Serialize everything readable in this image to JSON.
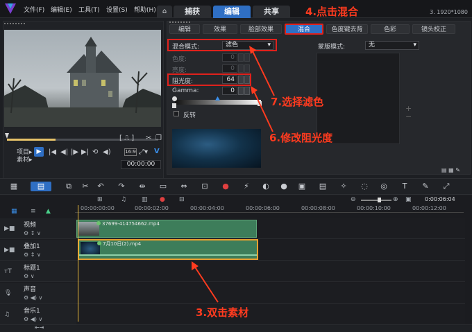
{
  "menu": [
    "文件(F)",
    "编辑(E)",
    "工具(T)",
    "设置(S)",
    "帮助(H)"
  ],
  "tabs": {
    "capture": "捕获",
    "edit": "编辑",
    "share": "共享"
  },
  "annotations": {
    "click_blend": "4.点击混合",
    "select_filter": "7.选择滤色",
    "modify_opacity": "6.修改阻光度",
    "double_click": "3.双击素材"
  },
  "resolution": "3. 1920*1080",
  "preview": {
    "project_label": "项目▸",
    "clip_label": "素材▸",
    "timecode": "00:00:00",
    "quality": "16:9"
  },
  "subtabs": [
    "编辑",
    "效果",
    "脸部效果",
    "混合",
    "色度键去背",
    "色彩",
    "镜头校正"
  ],
  "blend": {
    "mode_label": "混合模式:",
    "mode_value": "滤色",
    "hue_label": "色度:",
    "hue_value": "0",
    "brightness_label": "亮度:",
    "brightness_value": "0",
    "opacity_label": "阻光度:",
    "opacity_value": "64",
    "gamma_label": "Gamma:",
    "gamma_value": "0",
    "invert_label": "反转",
    "mask_mode_label": "蒙版模式:",
    "mask_mode_value": "无"
  },
  "timeline": {
    "ruler": [
      "00:00:00:00",
      "00:00:02:00",
      "00:00:04:00",
      "00:00:06:00",
      "00:00:08:00",
      "00:00:10:00",
      "00:00:12:00"
    ],
    "zoom_time": "0:00:06:04",
    "tracks": [
      {
        "name": "视频",
        "icon": "video-track-icon"
      },
      {
        "name": "叠加1",
        "icon": "overlay-track-icon"
      },
      {
        "name": "标题1",
        "icon": "title-track-icon"
      },
      {
        "name": "声音",
        "icon": "voice-track-icon"
      },
      {
        "name": "音乐1",
        "icon": "music-track-icon"
      }
    ],
    "clips": {
      "video": "37699-414754662.mp4",
      "overlay": "7月10日(2).mp4"
    }
  }
}
